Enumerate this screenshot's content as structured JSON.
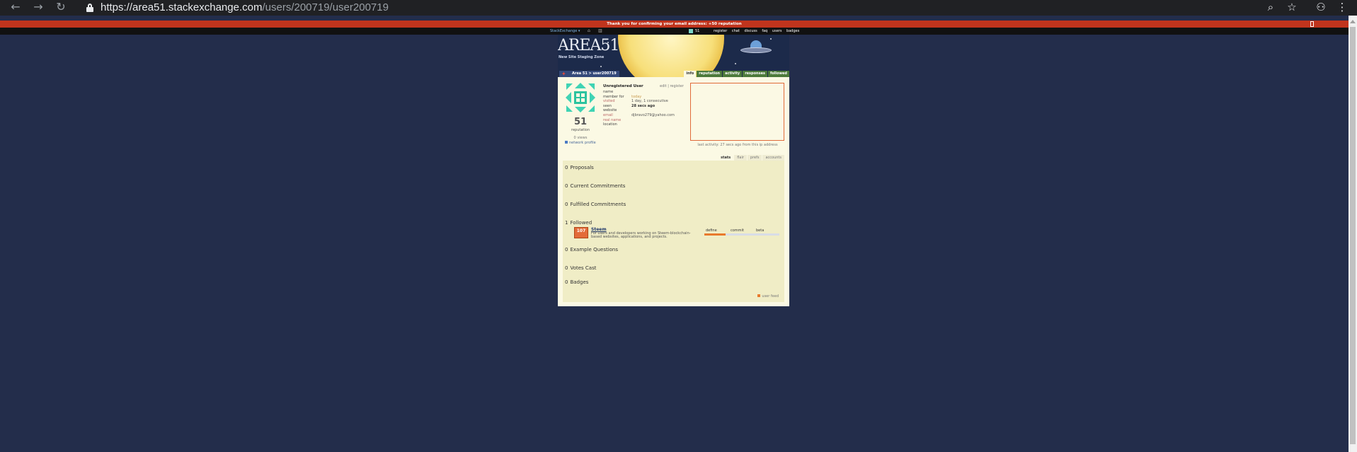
{
  "browser": {
    "url_host": "https://area51.stackexchange.com",
    "url_path": "/users/200719/user200719"
  },
  "notification": {
    "text": "Thank you for confirming your email address: +50 reputation"
  },
  "se_topbar": {
    "logo": "StackExchange ▾",
    "reputation": "51",
    "links": [
      "register",
      "chat",
      "discuss",
      "faq",
      "users",
      "badges"
    ]
  },
  "header": {
    "logo_title": "AREA51",
    "tagline": "New Site Staging Zone",
    "breadcrumb": "Area 51 > user200719",
    "tabs": [
      "info",
      "reputation",
      "activity",
      "responses",
      "followed"
    ],
    "active_tab": "info"
  },
  "profile": {
    "reputation": "51",
    "reputation_label": "reputation",
    "views": "0 views",
    "network_profile": "network profile",
    "name_heading": "Unregistered User",
    "edit_links": "edit | register",
    "fields": [
      {
        "label": "name",
        "value": ""
      },
      {
        "label": "member for",
        "value": "today"
      },
      {
        "label": "visited",
        "value": "1 day, 1 consecutive"
      },
      {
        "label": "seen",
        "value": "28 secs ago"
      },
      {
        "label": "website",
        "value": ""
      },
      {
        "label": "email",
        "value": "djbravo279@yahoo.com"
      },
      {
        "label": "real name",
        "value": ""
      },
      {
        "label": "location",
        "value": ""
      }
    ],
    "last_activity": "last activity: 27 secs ago from this ip address"
  },
  "subtabs": [
    "stats",
    "flair",
    "prefs",
    "accounts"
  ],
  "active_subtab": "stats",
  "stats": {
    "proposals": {
      "count": "0",
      "label": "Proposals"
    },
    "current_commitments": {
      "count": "0",
      "label": "Current Commitments"
    },
    "fulfilled_commitments": {
      "count": "0",
      "label": "Fulfilled Commitments"
    },
    "followed": {
      "count": "1",
      "label": "Followed"
    },
    "example_questions": {
      "count": "0",
      "label": "Example Questions"
    },
    "votes_cast": {
      "count": "0",
      "label": "Votes Cast"
    },
    "badges": {
      "count": "0",
      "label": "Badges"
    }
  },
  "followed_item": {
    "count": "107",
    "title": "Steem",
    "description": "For users and developers working on Steem-blockchain-based websites, applications, and projects.",
    "stages": [
      "define",
      "commit",
      "beta"
    ],
    "define_progress": 0.28
  },
  "user_feed": "user feed"
}
